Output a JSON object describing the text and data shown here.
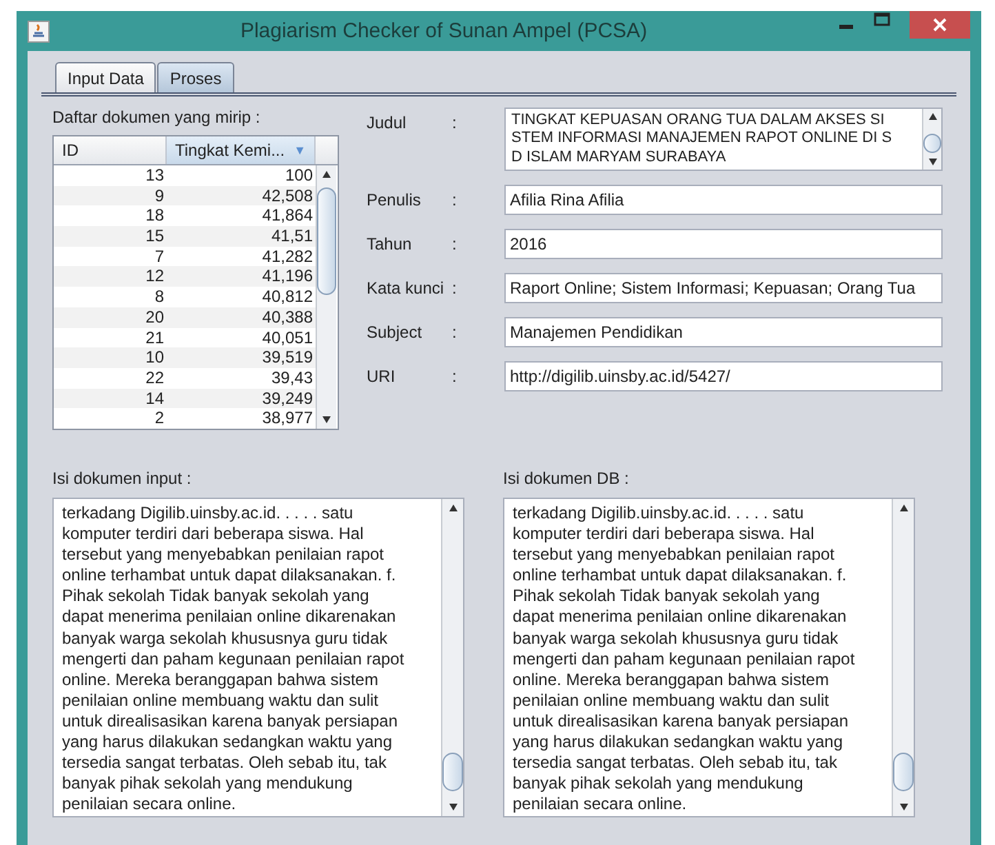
{
  "window": {
    "title": "Plagiarism Checker of Sunan Ampel (PCSA)"
  },
  "tabs": [
    {
      "label": "Input Data",
      "selected": false
    },
    {
      "label": "Proses",
      "selected": true
    }
  ],
  "similar_list": {
    "label": "Daftar dokumen yang mirip :",
    "columns": [
      {
        "label": "ID",
        "sorted": false
      },
      {
        "label": "Tingkat Kemi...",
        "sorted": true,
        "sort_icon": "▼"
      }
    ],
    "rows": [
      [
        "13",
        "100"
      ],
      [
        "9",
        "42,508"
      ],
      [
        "18",
        "41,864"
      ],
      [
        "15",
        "41,51"
      ],
      [
        "7",
        "41,282"
      ],
      [
        "12",
        "41,196"
      ],
      [
        "8",
        "40,812"
      ],
      [
        "20",
        "40,388"
      ],
      [
        "21",
        "40,051"
      ],
      [
        "10",
        "39,519"
      ],
      [
        "22",
        "39,43"
      ],
      [
        "14",
        "39,249"
      ],
      [
        "2",
        "38,977"
      ]
    ]
  },
  "fields": [
    {
      "kind": "area",
      "label": "Judul",
      "colon": ":",
      "lines": [
        "TINGKAT KEPUASAN ORANG TUA DALAM AKSES SI",
        "STEM INFORMASI MANAJEMEN RAPOT ONLINE DI S",
        "D ISLAM MARYAM SURABAYA"
      ]
    },
    {
      "kind": "line",
      "label": "Penulis",
      "colon": ":",
      "value": "Afilia Rina Afilia"
    },
    {
      "kind": "line",
      "label": "Tahun",
      "colon": ":",
      "value": "2016"
    },
    {
      "kind": "line",
      "label": "Kata kunci",
      "colon": ":",
      "value": "Raport Online;  Sistem Informasi;  Kepuasan;  Orang Tua"
    },
    {
      "kind": "line",
      "label": "Subject",
      "colon": ":",
      "value": "Manajemen Pendidikan"
    },
    {
      "kind": "line",
      "label": "URI",
      "colon": ":",
      "value": "http://digilib.uinsby.ac.id/5427/"
    }
  ],
  "documents": [
    {
      "label": "Isi dokumen input :",
      "lines": [
        "terkadang Digilib.uinsby.ac.id. . . . . satu",
        "komputer terdiri dari beberapa siswa. Hal",
        "tersebut yang menyebabkan penilaian rapot",
        "online terhambat untuk dapat dilaksanakan. f.",
        "Pihak sekolah Tidak banyak sekolah yang",
        "dapat menerima penilaian online dikarenakan",
        "banyak warga sekolah khususnya guru tidak",
        "mengerti dan paham kegunaan penilaian rapot",
        "online. Mereka beranggapan bahwa sistem",
        "penilaian online membuang waktu dan sulit",
        "untuk direalisasikan karena banyak persiapan",
        "yang harus dilakukan sedangkan waktu yang",
        "tersedia sangat terbatas. Oleh sebab itu, tak",
        "banyak pihak sekolah yang mendukung",
        "penilaian secara online."
      ]
    },
    {
      "label": "Isi dokumen DB :",
      "lines": [
        "terkadang Digilib.uinsby.ac.id. . . . . satu",
        "komputer terdiri dari beberapa siswa. Hal",
        "tersebut yang menyebabkan penilaian rapot",
        "online terhambat untuk dapat dilaksanakan. f.",
        "Pihak sekolah Tidak banyak sekolah yang",
        "dapat menerima penilaian online dikarenakan",
        "banyak warga sekolah khususnya guru tidak",
        "mengerti dan paham kegunaan penilaian rapot",
        "online. Mereka beranggapan bahwa sistem",
        "penilaian online membuang waktu dan sulit",
        "untuk direalisasikan karena banyak persiapan",
        "yang harus dilakukan sedangkan waktu yang",
        "tersedia sangat terbatas. Oleh sebab itu, tak",
        "banyak pihak sekolah yang mendukung",
        "penilaian secara online."
      ]
    }
  ]
}
